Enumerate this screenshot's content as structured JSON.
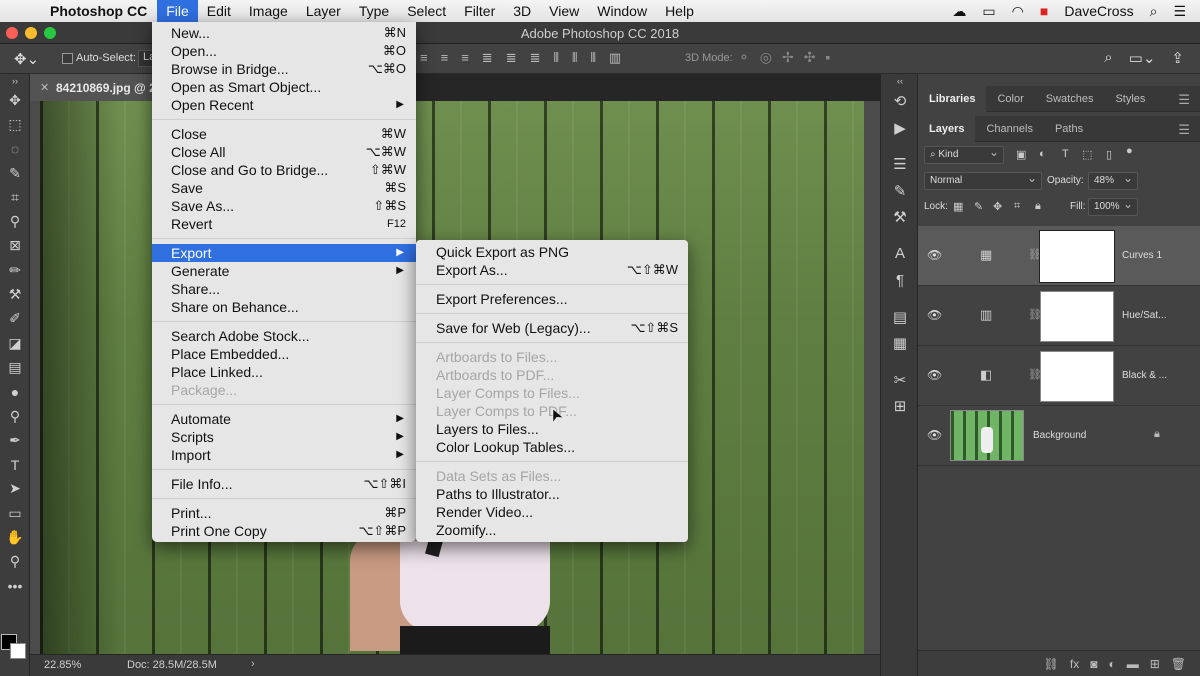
{
  "menubar": {
    "app_name": "Photoshop CC",
    "menus": [
      "File",
      "Edit",
      "Image",
      "Layer",
      "Type",
      "Select",
      "Filter",
      "3D",
      "View",
      "Window",
      "Help"
    ],
    "active_menu": "File",
    "user": "DaveCross"
  },
  "window": {
    "title": "Adobe Photoshop CC 2018"
  },
  "options_bar": {
    "auto_select_label": "Auto-Select:",
    "layer_select_value": "La",
    "mode_3d_label": "3D Mode:"
  },
  "document_tab": {
    "name": "84210869.jpg @ 2"
  },
  "status_bar": {
    "zoom": "22.85%",
    "doc_size": "Doc: 28.5M/28.5M"
  },
  "panels": {
    "top_tabs": [
      "Libraries",
      "Color",
      "Swatches",
      "Styles"
    ],
    "layer_tabs": [
      "Layers",
      "Channels",
      "Paths"
    ],
    "filter_kind": "Kind",
    "blend_mode": "Normal",
    "opacity_label": "Opacity:",
    "opacity_value": "48%",
    "lock_label": "Lock:",
    "fill_label": "Fill:",
    "fill_value": "100%",
    "layers": [
      {
        "name": "Curves 1",
        "selected": true
      },
      {
        "name": "Hue/Sat...",
        "selected": false
      },
      {
        "name": "Black & ...",
        "selected": false
      },
      {
        "name": "Background",
        "selected": false
      }
    ]
  },
  "file_menu": {
    "items": [
      {
        "label": "New...",
        "shortcut": "⌘N"
      },
      {
        "label": "Open...",
        "shortcut": "⌘O"
      },
      {
        "label": "Browse in Bridge...",
        "shortcut": "⌥⌘O"
      },
      {
        "label": "Open as Smart Object...",
        "shortcut": ""
      },
      {
        "label": "Open Recent",
        "shortcut": ""
      },
      {
        "label": "Close",
        "shortcut": "⌘W"
      },
      {
        "label": "Close All",
        "shortcut": "⌥⌘W"
      },
      {
        "label": "Close and Go to Bridge...",
        "shortcut": "⇧⌘W"
      },
      {
        "label": "Save",
        "shortcut": "⌘S"
      },
      {
        "label": "Save As...",
        "shortcut": "⇧⌘S"
      },
      {
        "label": "Revert",
        "shortcut": "F12"
      },
      {
        "label": "Export",
        "shortcut": ""
      },
      {
        "label": "Generate",
        "shortcut": ""
      },
      {
        "label": "Share...",
        "shortcut": ""
      },
      {
        "label": "Share on Behance...",
        "shortcut": ""
      },
      {
        "label": "Search Adobe Stock...",
        "shortcut": ""
      },
      {
        "label": "Place Embedded...",
        "shortcut": ""
      },
      {
        "label": "Place Linked...",
        "shortcut": ""
      },
      {
        "label": "Package...",
        "shortcut": ""
      },
      {
        "label": "Automate",
        "shortcut": ""
      },
      {
        "label": "Scripts",
        "shortcut": ""
      },
      {
        "label": "Import",
        "shortcut": ""
      },
      {
        "label": "File Info...",
        "shortcut": "⌥⇧⌘I"
      },
      {
        "label": "Print...",
        "shortcut": "⌘P"
      },
      {
        "label": "Print One Copy",
        "shortcut": "⌥⇧⌘P"
      }
    ]
  },
  "export_submenu": {
    "items": [
      {
        "label": "Quick Export as PNG",
        "shortcut": ""
      },
      {
        "label": "Export As...",
        "shortcut": "⌥⇧⌘W"
      },
      {
        "label": "Export Preferences...",
        "shortcut": ""
      },
      {
        "label": "Save for Web (Legacy)...",
        "shortcut": "⌥⇧⌘S"
      },
      {
        "label": "Artboards to Files...",
        "shortcut": ""
      },
      {
        "label": "Artboards to PDF...",
        "shortcut": ""
      },
      {
        "label": "Layer Comps to Files...",
        "shortcut": ""
      },
      {
        "label": "Layer Comps to PDF...",
        "shortcut": ""
      },
      {
        "label": "Layers to Files...",
        "shortcut": ""
      },
      {
        "label": "Color Lookup Tables...",
        "shortcut": ""
      },
      {
        "label": "Data Sets as Files...",
        "shortcut": ""
      },
      {
        "label": "Paths to Illustrator...",
        "shortcut": ""
      },
      {
        "label": "Render Video...",
        "shortcut": ""
      },
      {
        "label": "Zoomify...",
        "shortcut": ""
      }
    ]
  },
  "colors": {
    "menu_highlight": "#2f6fe0",
    "menu_background": "#e6e6e6",
    "panel_background": "#424242"
  }
}
